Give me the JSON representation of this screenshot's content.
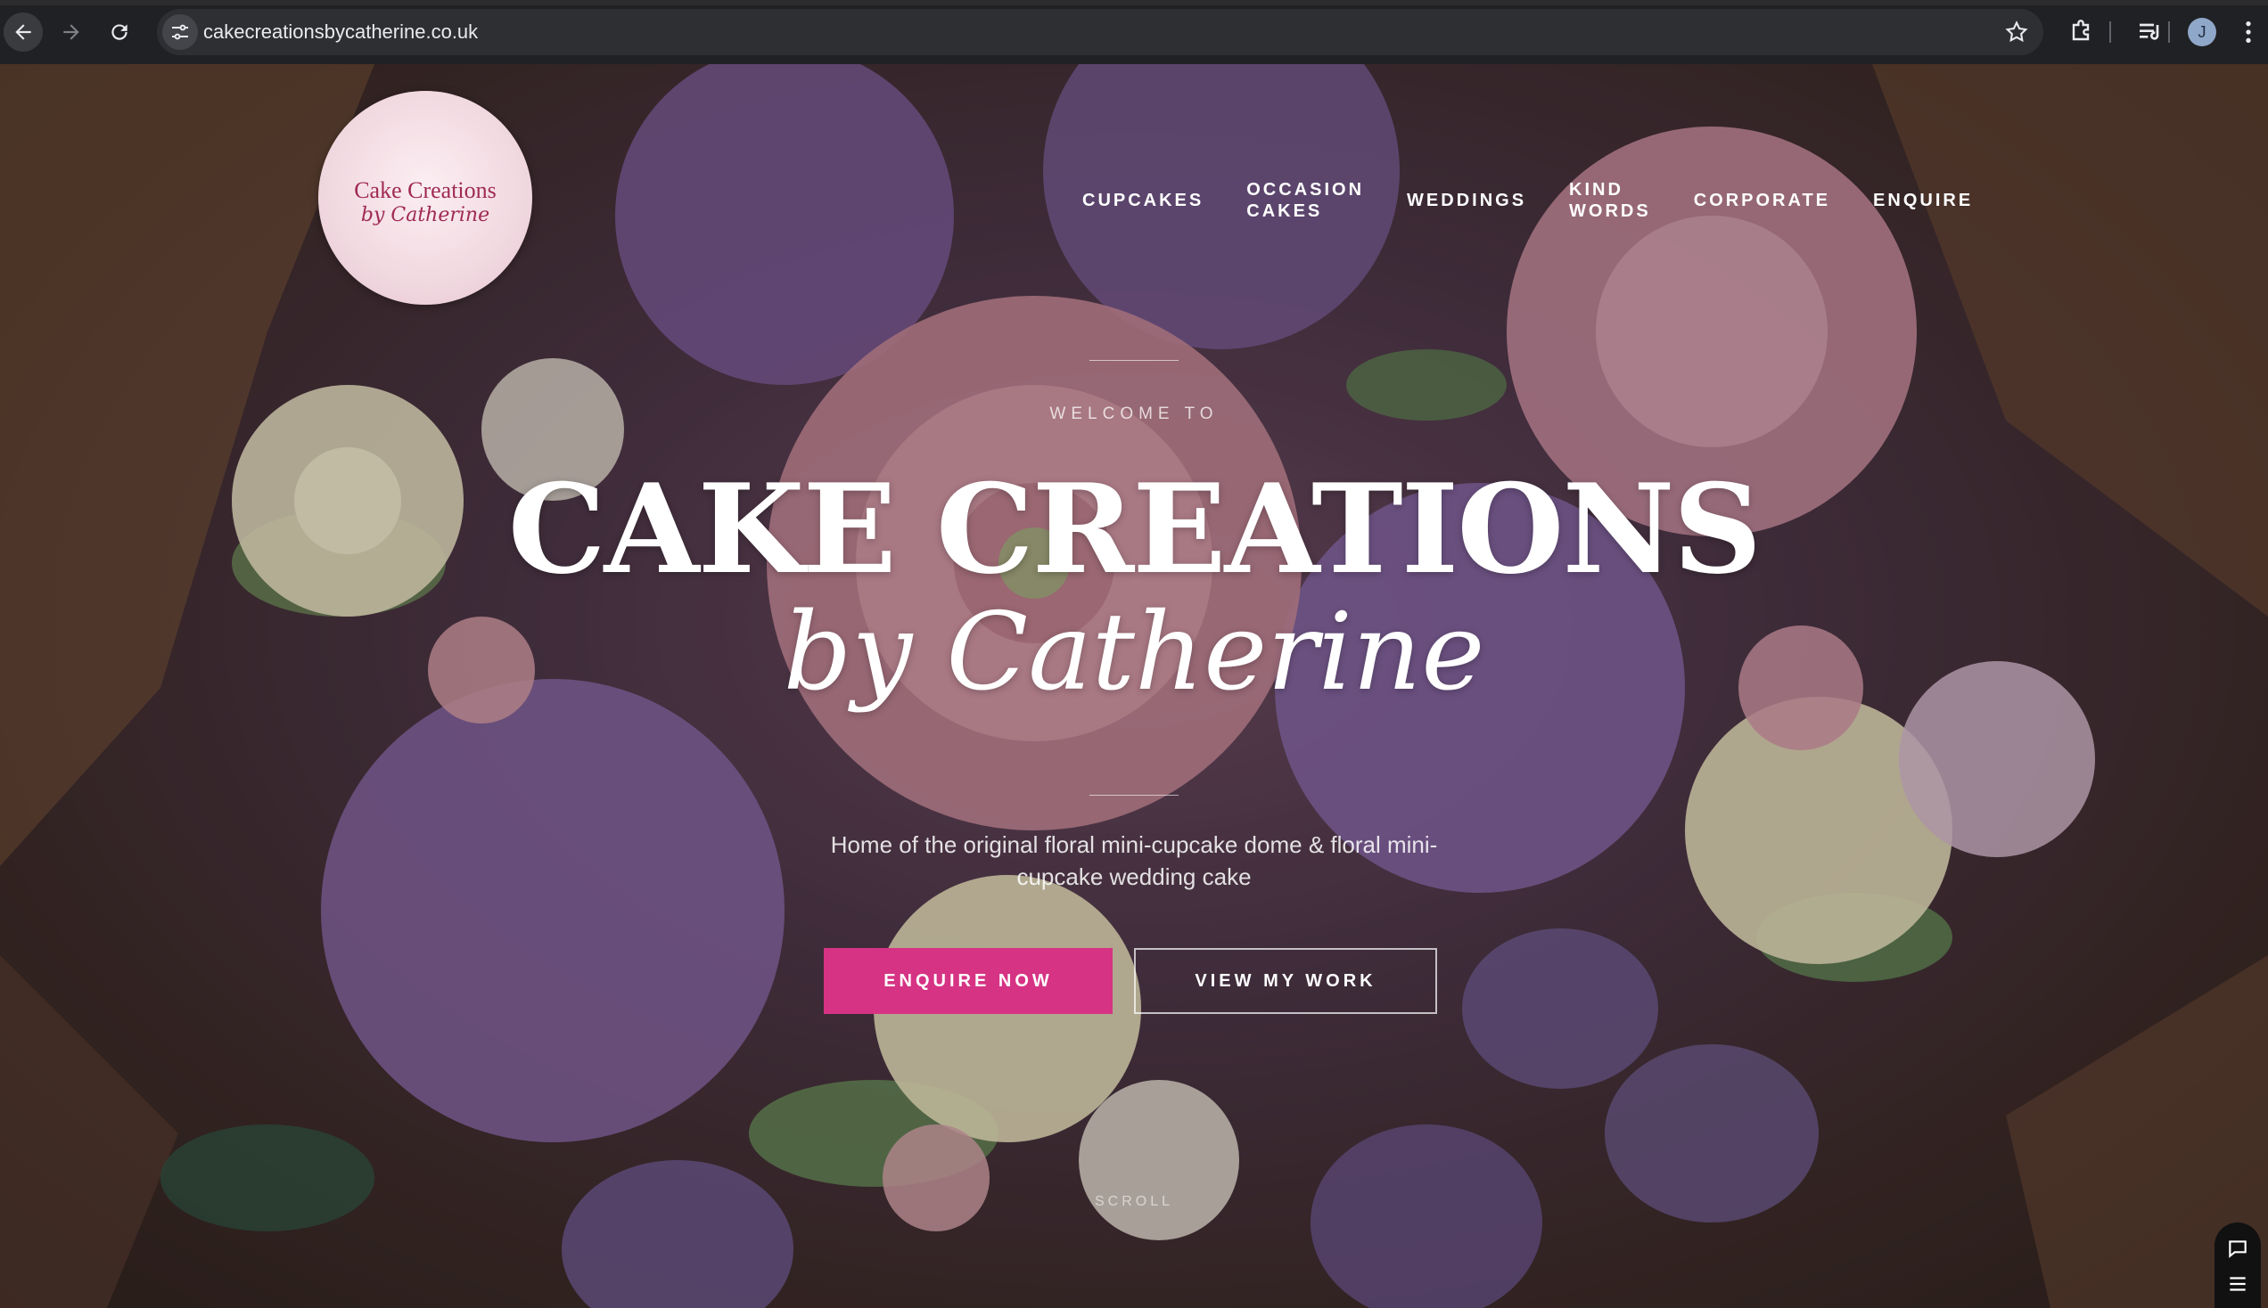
{
  "browser": {
    "url": "cakecreationsbycatherine.co.uk",
    "profile_initial": "J"
  },
  "site": {
    "logo": {
      "title": "Cake Creations",
      "subtitle": "by Catherine"
    },
    "nav": [
      {
        "label": "CUPCAKES"
      },
      {
        "label": "OCCASION\nCAKES"
      },
      {
        "label": "WEDDINGS"
      },
      {
        "label": "KIND\nWORDS"
      },
      {
        "label": "CORPORATE"
      },
      {
        "label": "ENQUIRE"
      }
    ],
    "hero": {
      "kicker": "WELCOME TO",
      "title": "CAKE CREATIONS",
      "script": "by Catherine",
      "tagline": "Home of the original floral mini-cupcake dome & floral mini-cupcake wedding cake",
      "primary_cta": "ENQUIRE NOW",
      "secondary_cta": "VIEW MY WORK",
      "scroll": "SCROLL"
    },
    "colors": {
      "accent": "#d63384",
      "text": "#ffffff"
    }
  }
}
